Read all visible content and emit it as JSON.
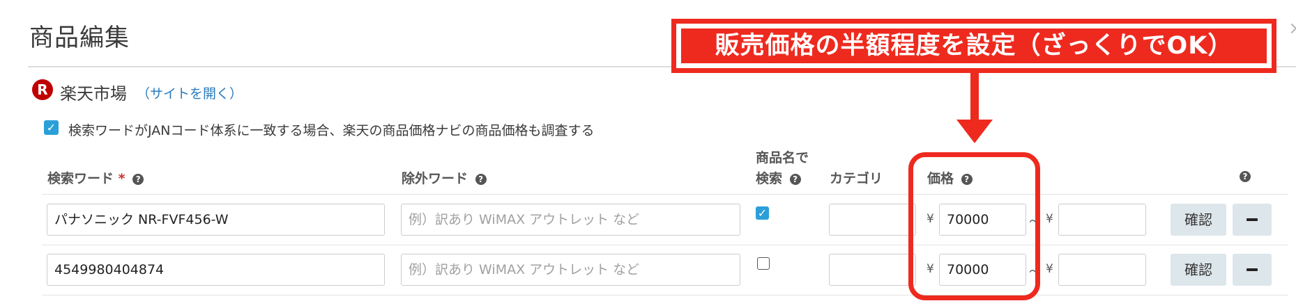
{
  "page": {
    "title": "商品編集",
    "close_glyph": "×"
  },
  "store": {
    "logo_letter": "R",
    "name": "楽天市場",
    "link": "（サイトを開く）",
    "jan_checkbox_checked": true,
    "jan_label": "検索ワードがJANコード体系に一致する場合、楽天の商品価格ナビの商品価格も調査する"
  },
  "columns": {
    "search_word": "検索ワード",
    "required_mark": "*",
    "exclude_word": "除外ワード",
    "search_by_name_line1": "商品名で",
    "search_by_name_line2": "検索",
    "category": "カテゴリ",
    "price": "価格",
    "help_glyph": "?"
  },
  "rows": [
    {
      "search_word": "パナソニック NR-FVF456-W",
      "exclude_placeholder": "例）訳あり WiMAX アウトレット など",
      "search_by_name": true,
      "category": "",
      "currency": "¥",
      "price_min": "70000",
      "range_sep": "〜",
      "price_max": "",
      "confirm_label": "確認"
    },
    {
      "search_word": "4549980404874",
      "exclude_placeholder": "例）訳あり WiMAX アウトレット など",
      "search_by_name": false,
      "category": "",
      "currency": "¥",
      "price_min": "70000",
      "range_sep": "〜",
      "price_max": "",
      "confirm_label": "確認"
    }
  ],
  "annotation": {
    "banner_text": "販売価格の半額程度を設定（ざっくりでOK）",
    "color": "#ee2a1f"
  }
}
